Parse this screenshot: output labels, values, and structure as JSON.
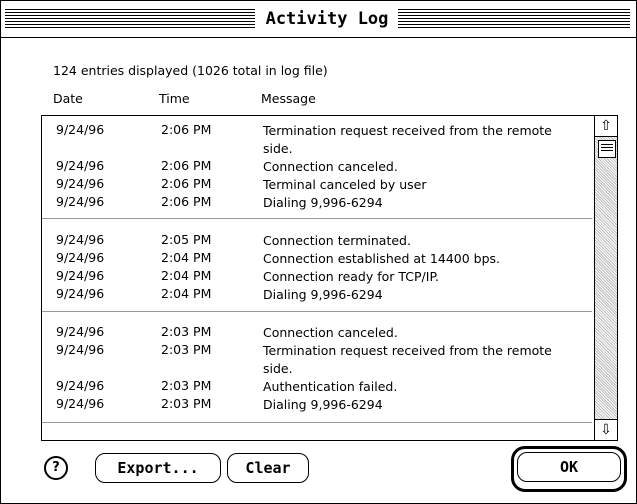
{
  "window": {
    "title": "Activity Log"
  },
  "summary": "124 entries displayed   (1026 total in log file)",
  "columns": {
    "date": "Date",
    "time": "Time",
    "message": "Message"
  },
  "rows": [
    {
      "date": "9/24/96",
      "time": "2:06 PM",
      "msg": "Termination request received from the remote side."
    },
    {
      "date": "9/24/96",
      "time": "2:06 PM",
      "msg": "Connection canceled."
    },
    {
      "date": "9/24/96",
      "time": "2:06 PM",
      "msg": "Terminal canceled by user"
    },
    {
      "date": "9/24/96",
      "time": "2:06 PM",
      "msg": "Dialing 9,996-6294"
    },
    {
      "date": "9/24/96",
      "time": "2:05 PM",
      "msg": "Connection terminated."
    },
    {
      "date": "9/24/96",
      "time": "2:04 PM",
      "msg": "Connection established at 14400 bps."
    },
    {
      "date": "9/24/96",
      "time": "2:04 PM",
      "msg": "Connection ready for TCP/IP."
    },
    {
      "date": "9/24/96",
      "time": "2:04 PM",
      "msg": "Dialing 9,996-6294"
    },
    {
      "date": "9/24/96",
      "time": "2:03 PM",
      "msg": "Connection canceled."
    },
    {
      "date": "9/24/96",
      "time": "2:03 PM",
      "msg": "Termination request received from the remote side."
    },
    {
      "date": "9/24/96",
      "time": "2:03 PM",
      "msg": "Authentication failed."
    },
    {
      "date": "9/24/96",
      "time": "2:03 PM",
      "msg": "Dialing 9,996-6294"
    }
  ],
  "buttons": {
    "help": "?",
    "export": "Export...",
    "clear": "Clear",
    "ok": "OK"
  },
  "icons": {
    "scroll_up": "up-arrow-icon",
    "scroll_down": "down-arrow-icon",
    "help": "question-icon"
  }
}
